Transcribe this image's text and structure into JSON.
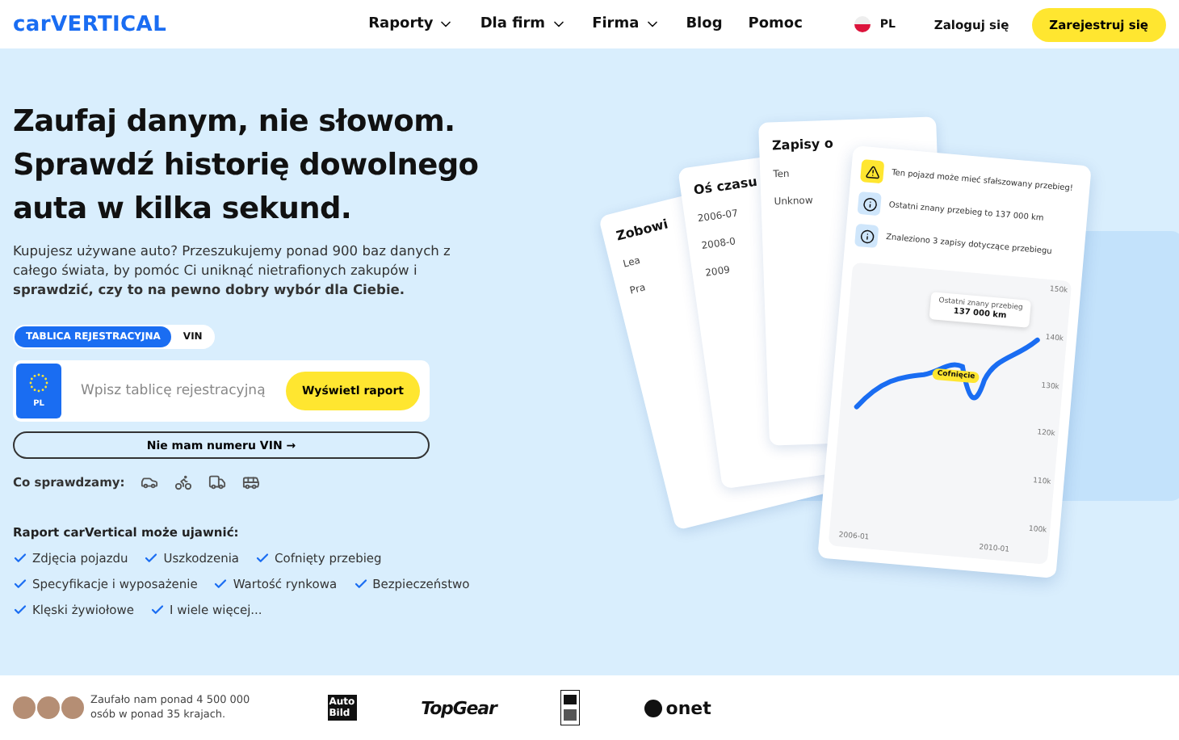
{
  "nav": {
    "logo": "carVERTICAL",
    "menu": [
      {
        "label": "Raporty",
        "dropdown": true
      },
      {
        "label": "Dla firm",
        "dropdown": true
      },
      {
        "label": "Firma",
        "dropdown": true
      },
      {
        "label": "Blog",
        "dropdown": false
      },
      {
        "label": "Pomoc",
        "dropdown": false
      }
    ],
    "language": "PL",
    "login": "Zaloguj się",
    "register": "Zarejestruj się"
  },
  "hero": {
    "headline": [
      "Zaufaj danym, nie słowom.",
      "Sprawdź historię dowolnego",
      "auta w kilka sekund."
    ],
    "intro": "Kupujesz używane auto? Przeszukujemy ponad 900 baz danych z całego świata, by pomóc Ci uniknąć nietrafionych zakupów i **sprawdzić, czy to na pewno dobry wybór dla Ciebie.**",
    "tabs": [
      {
        "label": "TABLICA REJESTRACYJNA",
        "selected": true
      },
      {
        "label": "VIN",
        "selected": false
      }
    ],
    "plate_country": "PL",
    "placeholder": "Wpisz tablicę rejestracyjną",
    "submit": "Wyświetl raport",
    "no_vin": "Nie mam numeru VIN →",
    "checks_label": "Co sprawdzamy:",
    "reveal_title": "Raport carVertical może ujawnić:",
    "reveal_rows": [
      [
        "Zdjęcia pojazdu",
        "Uszkodzenia",
        "Cofnięty przebieg"
      ],
      [
        "Specyfikacje i wyposażenie",
        "Wartość rynkowa",
        "Bezpieczeństwo"
      ],
      [
        "Klęski żywiołowe",
        "I wiele więcej..."
      ]
    ]
  },
  "illustration": {
    "back_cards": [
      {
        "title": "Zobowi",
        "lines": [
          "Lea",
          "Pra"
        ]
      },
      {
        "title": "Oś czasu",
        "lines": [
          "2006-07",
          "2008-0",
          "2009"
        ]
      },
      {
        "title": "Zapisy o",
        "lines": [
          "Ten",
          "Unknow"
        ]
      }
    ],
    "alerts": [
      {
        "kind": "warning",
        "text": "Ten pojazd może mieć sfałszowany przebieg!"
      },
      {
        "kind": "info",
        "text": "Ostatni znany przebieg to 137 000 km"
      },
      {
        "kind": "info",
        "text": "Znaleziono 3 zapisy dotyczące przebiegu"
      }
    ],
    "tooltip_title": "Ostatni znany przebieg",
    "tooltip_value": "137 000 km",
    "rollback": "Cofnięcie",
    "y_labels": [
      "150k",
      "140k",
      "130k",
      "120k",
      "110k",
      "100k"
    ],
    "x_labels": [
      "2006-01",
      "2010-01"
    ]
  },
  "footer": {
    "trust": [
      "Zaufało nam ponad 4 500 000",
      "osób w ponad 35 krajach."
    ],
    "logos": [
      {
        "kind": "stacked",
        "lines": [
          "Auto",
          "Bild"
        ]
      },
      {
        "kind": "italic",
        "text": "TopGear"
      },
      {
        "kind": "emblem"
      },
      {
        "kind": "dot",
        "text": "onet"
      }
    ]
  }
}
